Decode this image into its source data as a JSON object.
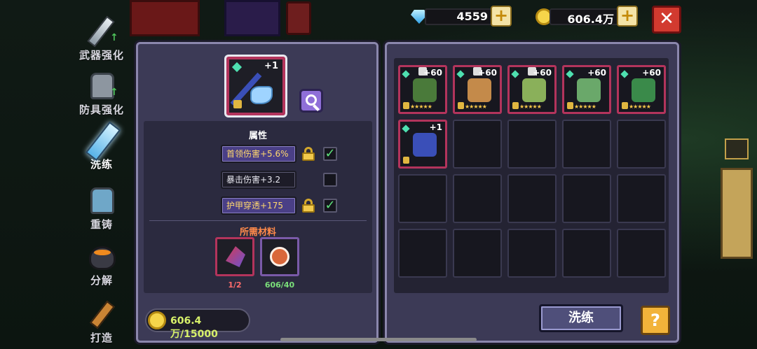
{
  "resources": {
    "gems": "4559",
    "gold": "606.4万"
  },
  "sidebar": {
    "items": [
      {
        "label": "武器强化"
      },
      {
        "label": "防具强化"
      },
      {
        "label": "洗练"
      },
      {
        "label": "重铸"
      },
      {
        "label": "分解"
      },
      {
        "label": "打造"
      }
    ]
  },
  "selected_item": {
    "level": "+1"
  },
  "attributes": {
    "title": "属性",
    "rows": [
      {
        "text": "首领伤害+5.6%",
        "locked": true,
        "checked": true
      },
      {
        "text": "暴击伤害+3.2",
        "locked": false,
        "checked": false
      },
      {
        "text": "护甲穿透+175",
        "locked": true,
        "checked": true
      }
    ]
  },
  "materials": {
    "title": "所需材料",
    "items": [
      {
        "count": "1/2"
      },
      {
        "count": "606/40"
      }
    ]
  },
  "cost": "606.4万/15000",
  "inventory": {
    "row1": [
      {
        "level": "+60"
      },
      {
        "level": "+60"
      },
      {
        "level": "+60"
      },
      {
        "level": "+60"
      },
      {
        "level": "+60"
      }
    ],
    "row2_first": {
      "level": "+1"
    },
    "stars": "★★★★★"
  },
  "buttons": {
    "wash": "洗练",
    "help": "?",
    "close": "✕",
    "plus": "+"
  },
  "colors": {
    "rarity_red": "#b3345c",
    "panel": "#3c3a56",
    "accent_gold": "#f2b33a"
  }
}
